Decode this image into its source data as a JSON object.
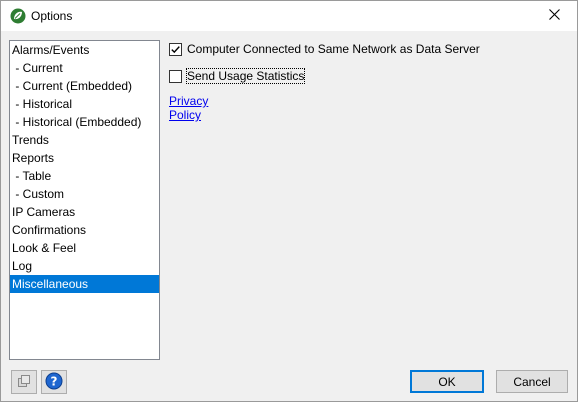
{
  "window": {
    "title": "Options",
    "app_icon": "leaf-logo-icon",
    "close_icon": "close-icon"
  },
  "sidebar": {
    "items": [
      {
        "label": "Alarms/Events",
        "selected": false
      },
      {
        "label": " - Current",
        "selected": false
      },
      {
        "label": " - Current (Embedded)",
        "selected": false
      },
      {
        "label": " - Historical",
        "selected": false
      },
      {
        "label": " - Historical (Embedded)",
        "selected": false
      },
      {
        "label": "Trends",
        "selected": false
      },
      {
        "label": "Reports",
        "selected": false
      },
      {
        "label": " - Table",
        "selected": false
      },
      {
        "label": " - Custom",
        "selected": false
      },
      {
        "label": "IP Cameras",
        "selected": false
      },
      {
        "label": "Confirmations",
        "selected": false
      },
      {
        "label": "Look & Feel",
        "selected": false
      },
      {
        "label": "Log",
        "selected": false
      },
      {
        "label": "Miscellaneous",
        "selected": true
      }
    ]
  },
  "misc": {
    "same_network": {
      "label": "Computer Connected to Same Network as Data Server",
      "checked": true
    },
    "usage_stats": {
      "label": "Send Usage Statistics",
      "checked": false
    },
    "privacy_link": "Privacy Policy"
  },
  "footer": {
    "left_icon": "window-restore-icon",
    "help_icon": "help-icon",
    "ok_label": "OK",
    "cancel_label": "Cancel"
  },
  "colors": {
    "selection": "#0078d7",
    "link": "#0000ee",
    "dialog_bg": "#f0f0f0"
  }
}
